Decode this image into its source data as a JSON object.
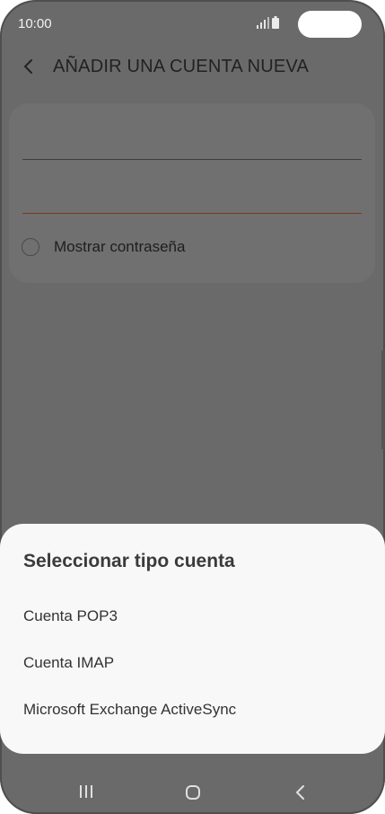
{
  "status_bar": {
    "time": "10:00",
    "signal_icon": "signal-icon",
    "battery_icon": "battery-icon"
  },
  "app_bar": {
    "back_icon": "chevron-left-icon",
    "title": "AÑADIR UNA CUENTA NUEVA"
  },
  "form": {
    "email_value": "",
    "password_value": "",
    "show_password_label": "Mostrar contraseña",
    "show_password_checked": false
  },
  "dialog": {
    "title": "Seleccionar tipo cuenta",
    "options": [
      "Cuenta POP3",
      "Cuenta IMAP",
      "Microsoft Exchange ActiveSync"
    ]
  },
  "nav_bar": {
    "recents_icon": "recents-icon",
    "home_icon": "home-icon",
    "back_icon": "back-icon"
  },
  "colors": {
    "overlay_bg": "#6a6a6a",
    "sheet_bg": "#f8f8f8",
    "accent_underline": "#7a3a22"
  }
}
